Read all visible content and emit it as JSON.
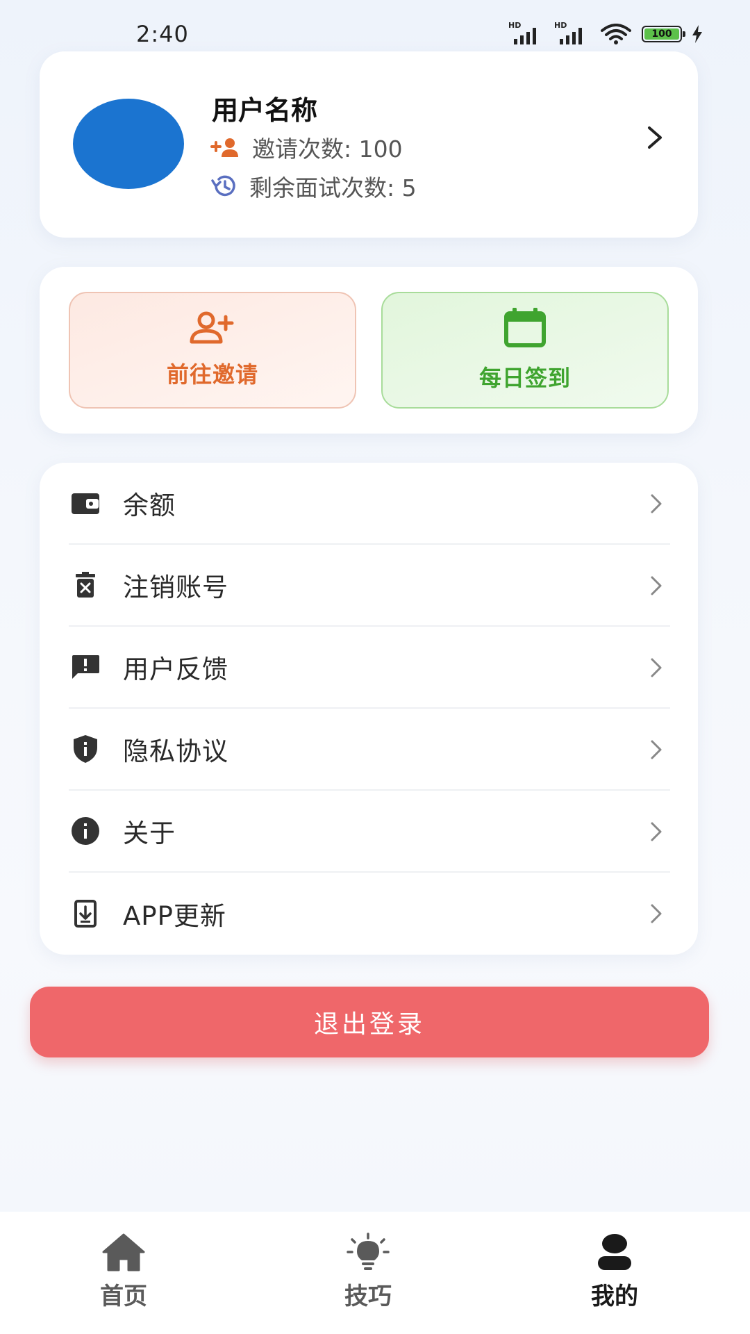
{
  "status_bar": {
    "time": "2:40",
    "signal1_label": "HD",
    "signal2_label": "HD",
    "battery": "100",
    "icons": [
      "signal-icon",
      "signal-icon",
      "wifi-icon",
      "battery-icon",
      "charging-icon"
    ]
  },
  "profile": {
    "username": "用户名称",
    "invite_count_label": "邀请次数: 100",
    "remaining_interviews_label": "剩余面试次数: 5",
    "avatar_color": "#1b74d0"
  },
  "actions": {
    "invite_label": "前往邀请",
    "checkin_label": "每日签到",
    "invite_color": "#e0692c",
    "checkin_color": "#3fa42f"
  },
  "menu": {
    "items": [
      {
        "label": "余额",
        "icon": "wallet-icon"
      },
      {
        "label": "注销账号",
        "icon": "delete-icon"
      },
      {
        "label": "用户反馈",
        "icon": "feedback-icon"
      },
      {
        "label": "隐私协议",
        "icon": "shield-icon"
      },
      {
        "label": "关于",
        "icon": "info-icon"
      },
      {
        "label": "APP更新",
        "icon": "download-icon"
      }
    ]
  },
  "logout": {
    "label": "退出登录",
    "color": "#ef676a"
  },
  "tabs": [
    {
      "label": "首页",
      "icon": "home-icon"
    },
    {
      "label": "技巧",
      "icon": "lightbulb-icon"
    },
    {
      "label": "我的",
      "icon": "person-icon",
      "active": true
    }
  ]
}
